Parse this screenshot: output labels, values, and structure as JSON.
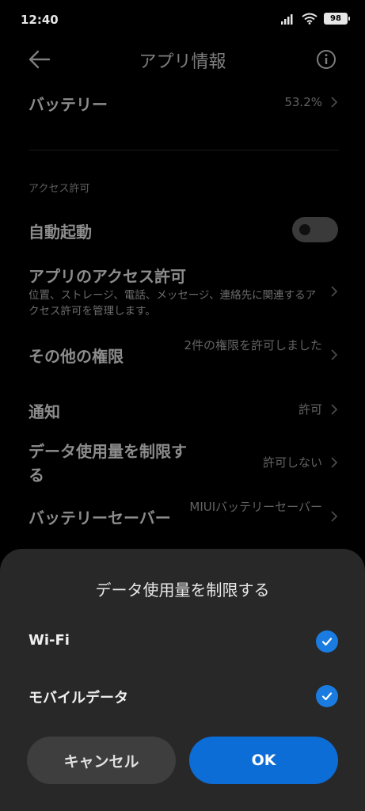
{
  "status": {
    "time": "12:40",
    "battery": "98",
    "icons": [
      "signal-icon",
      "wifi-icon",
      "battery-icon"
    ]
  },
  "header": {
    "title": "アプリ情報",
    "back_icon": "back-arrow-icon",
    "info_icon": "info-icon"
  },
  "battery_row": {
    "title": "バッテリー",
    "value": "53.2%"
  },
  "section": {
    "label": "アクセス許可"
  },
  "autostart": {
    "title": "自動起動",
    "enabled": false
  },
  "app_permissions": {
    "title": "アプリのアクセス許可",
    "subtitle": "位置、ストレージ、電話、メッセージ、連絡先に関連するアクセス許可を管理します。"
  },
  "other_permissions": {
    "title": "その他の権限",
    "value": "2件の権限を許可しました"
  },
  "notifications": {
    "title": "通知",
    "value": "許可"
  },
  "data_restrict": {
    "title": "データ使用量を制限する",
    "value": "許可しない"
  },
  "battery_saver": {
    "title": "バッテリーセーバー",
    "value": "MIUIバッテリーセーバー"
  },
  "sheet": {
    "title": "データ使用量を制限する",
    "options": [
      {
        "label": "Wi-Fi",
        "checked": true
      },
      {
        "label": "モバイルデータ",
        "checked": true
      }
    ],
    "cancel_label": "キャンセル",
    "ok_label": "OK"
  },
  "colors": {
    "accent": "#0d6dd6",
    "sheet_bg": "#282828",
    "background": "#000000"
  }
}
